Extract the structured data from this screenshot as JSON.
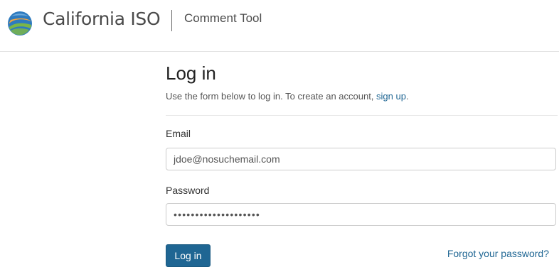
{
  "header": {
    "brand_name": "California ISO",
    "app_name": "Comment Tool",
    "logo_icon": "california-iso-globe-logo"
  },
  "login": {
    "title": "Log in",
    "intro_text": "Use the form below to log in. To create an account, ",
    "signup_link": "sign up",
    "intro_suffix": ".",
    "email_label": "Email",
    "email_value": "jdoe@nosuchemail.com",
    "password_label": "Password",
    "password_masked": "••••••••••••••••••••",
    "submit_label": "Log in",
    "forgot_link": "Forgot your password?"
  },
  "colors": {
    "accent": "#1f6693",
    "logo_blue": "#2e7bbf",
    "logo_green": "#7ab648",
    "logo_orange": "#f2a541"
  }
}
